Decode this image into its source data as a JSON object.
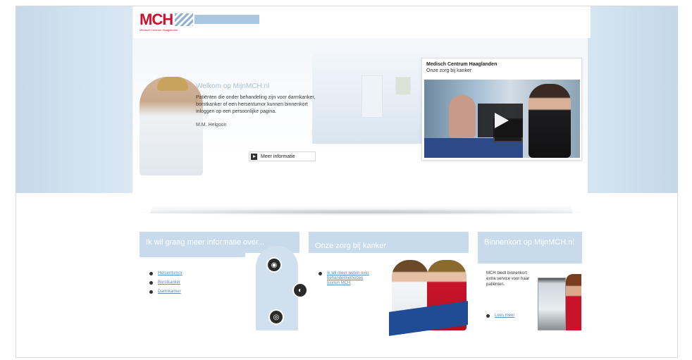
{
  "header": {
    "logo_text": "MCH",
    "logo_subtext": "Medisch Centrum Haaglanden"
  },
  "hero": {
    "welcome_title": "Welkom op MijnMCH.nl",
    "welcome_text": "Patiënten die onder behandeling zijn voor darmkanker, borstkanker of een hersentumor kunnen binnenkort inloggen op een persoonlijke pagina.",
    "signature": "M.M. Helgoon",
    "more_button_label": "Meer informatie"
  },
  "video": {
    "title": "Medisch Centrum Haaglanden",
    "subtitle": "Onze zorg bij kanker"
  },
  "boxes": {
    "info": {
      "title": "Ik wil graag meer informatie over...",
      "links": [
        "Hersentumor",
        "Borstkanker",
        "Darmkanker"
      ]
    },
    "care": {
      "title": "Onze zorg bij kanker",
      "link": "Ik wil meer weten over behandelmethoden binnen MCH"
    },
    "soon": {
      "title": "Binnenkort op MijnMCH.nl",
      "text": "MCH biedt binnenkort extra service voor haar patiënten.",
      "link": "Lees meer"
    }
  },
  "colors": {
    "brand_red": "#d0102b",
    "panel_blue": "#c8dbec",
    "link_blue": "#5e8cb4"
  }
}
